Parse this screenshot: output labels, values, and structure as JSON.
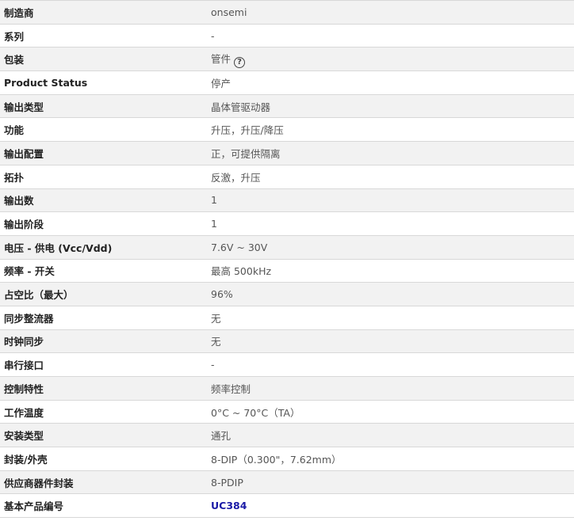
{
  "rows": [
    {
      "label": "制造商",
      "value": "onsemi"
    },
    {
      "label": "系列",
      "value": "-"
    },
    {
      "label": "包装",
      "value": "管件",
      "help_icon": "question-circle-icon"
    },
    {
      "label": "Product Status",
      "value": "停产"
    },
    {
      "label": "输出类型",
      "value": "晶体管驱动器"
    },
    {
      "label": "功能",
      "value": "升压，升压/降压"
    },
    {
      "label": "输出配置",
      "value": "正，可提供隔离"
    },
    {
      "label": "拓扑",
      "value": "反激，升压"
    },
    {
      "label": "输出数",
      "value": "1"
    },
    {
      "label": "输出阶段",
      "value": "1"
    },
    {
      "label": "电压 - 供电 (Vcc/Vdd)",
      "value": "7.6V ~ 30V"
    },
    {
      "label": "频率 - 开关",
      "value": "最高 500kHz"
    },
    {
      "label": "占空比（最大）",
      "value": "96%"
    },
    {
      "label": "同步整流器",
      "value": "无"
    },
    {
      "label": "时钟同步",
      "value": "无"
    },
    {
      "label": "串行接口",
      "value": "-"
    },
    {
      "label": "控制特性",
      "value": "频率控制"
    },
    {
      "label": "工作温度",
      "value": "0°C ~ 70°C（TA）"
    },
    {
      "label": "安装类型",
      "value": "通孔"
    },
    {
      "label": "封装/外壳",
      "value": "8-DIP（0.300\"，7.62mm）"
    },
    {
      "label": "供应商器件封装",
      "value": "8-PDIP"
    },
    {
      "label": "基本产品编号",
      "value": "UC384",
      "link": true
    }
  ],
  "colors": {
    "link": "#1a1aa6",
    "row_alt": "#f2f2f2",
    "border": "#d8d8d8"
  }
}
